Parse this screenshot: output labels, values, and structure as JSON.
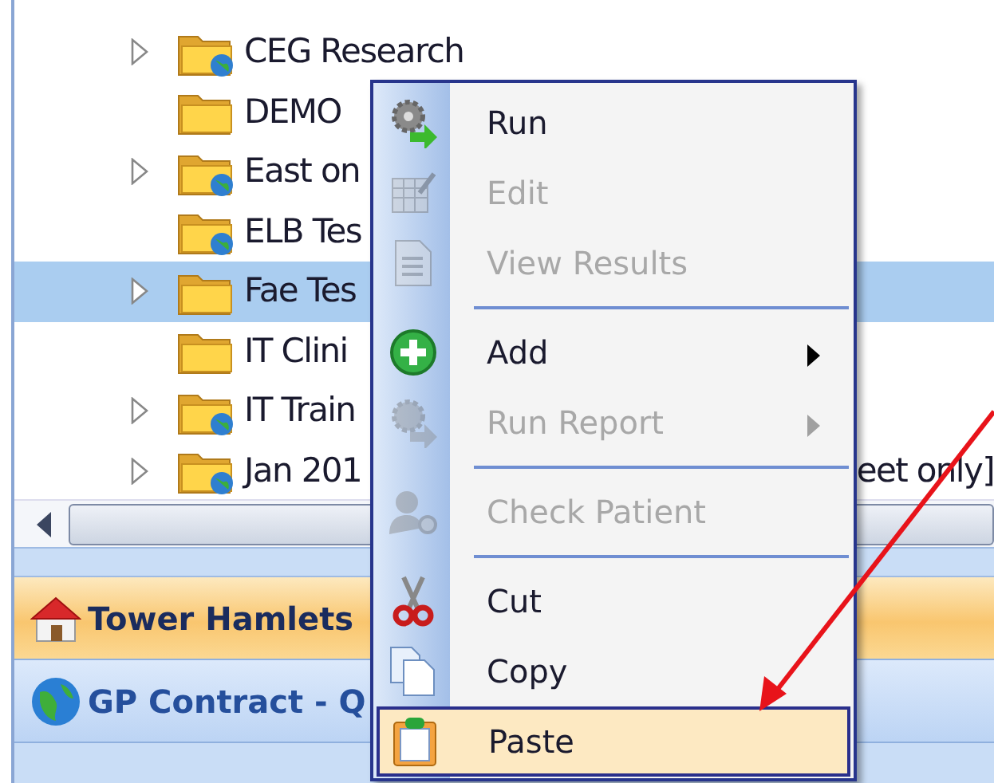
{
  "tree": {
    "items": [
      {
        "label": "CEG Research",
        "expandable": true,
        "kind": "globe-folder",
        "selected": false
      },
      {
        "label": "DEMO",
        "expandable": false,
        "kind": "folder",
        "selected": false
      },
      {
        "label": "East on",
        "expandable": true,
        "kind": "globe-folder",
        "selected": false
      },
      {
        "label": "ELB Tes",
        "expandable": false,
        "kind": "globe-folder",
        "selected": false
      },
      {
        "label": "Fae Tes",
        "expandable": true,
        "kind": "folder",
        "selected": true
      },
      {
        "label": "IT Clini",
        "expandable": false,
        "kind": "folder",
        "selected": false
      },
      {
        "label": "IT Train",
        "expandable": true,
        "kind": "globe-folder",
        "selected": false
      },
      {
        "label": "Jan 201",
        "tail": "eet only]",
        "expandable": true,
        "kind": "globe-folder",
        "selected": false
      }
    ]
  },
  "nav_bars": [
    {
      "label": "Tower Hamlets",
      "kind": "home",
      "selected": true
    },
    {
      "label": "GP Contract - Q",
      "kind": "globe",
      "selected": false
    }
  ],
  "context_menu": {
    "items": [
      {
        "kind": "item",
        "label": "Run",
        "disabled": false,
        "submenu": false,
        "selected": false
      },
      {
        "kind": "item",
        "label": "Edit",
        "disabled": true,
        "submenu": false,
        "selected": false
      },
      {
        "kind": "item",
        "label": "View Results",
        "disabled": true,
        "submenu": false,
        "selected": false
      },
      {
        "kind": "separator"
      },
      {
        "kind": "item",
        "label": "Add",
        "disabled": false,
        "submenu": true,
        "selected": false
      },
      {
        "kind": "item",
        "label": "Run Report",
        "disabled": true,
        "submenu": true,
        "selected": false
      },
      {
        "kind": "separator"
      },
      {
        "kind": "item",
        "label": "Check Patient",
        "disabled": true,
        "submenu": false,
        "selected": false
      },
      {
        "kind": "separator"
      },
      {
        "kind": "item",
        "label": "Cut",
        "disabled": false,
        "submenu": false,
        "selected": false
      },
      {
        "kind": "item",
        "label": "Copy",
        "disabled": false,
        "submenu": false,
        "selected": false
      },
      {
        "kind": "item",
        "label": "Paste",
        "disabled": false,
        "submenu": false,
        "selected": true
      }
    ]
  }
}
